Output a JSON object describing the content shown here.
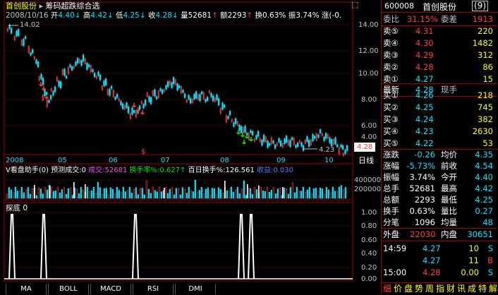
{
  "chart_header": {
    "stock_name": "首创股份",
    "indicator": "筹码超跌综合选",
    "date": "2008/10/16",
    "open_label": "开",
    "open": "4.40",
    "high_label": "高",
    "high": "4.42",
    "low_label": "低",
    "low": "4.25",
    "close_label": "收",
    "close": "4.28",
    "volume_label": "量",
    "volume": "52681",
    "amount_label": "额",
    "amount": "2293",
    "turnover_label": "换",
    "turnover": "0.63%",
    "amplitude_label": "振",
    "amplitude": "3.74%",
    "change_label": "涨",
    "change": "(-0.",
    "high_mark": "14.02",
    "low_mark": "4.23",
    "current_price_tag": "4.28"
  },
  "price_axis": [
    "14.00",
    "12.00",
    "10.00",
    "8.00",
    "6.00",
    "4.00"
  ],
  "date_axis": [
    "2008",
    "05",
    "06",
    "07",
    "08",
    "09",
    "10"
  ],
  "date_axis_right": "日线",
  "volume_header": {
    "title": "V看盘助手",
    "param": "(0)",
    "forecast_label": "预测成交:0",
    "deal_label": "成交:",
    "deal_value": "52681",
    "turnover_rate_label": "换手率%:",
    "turnover_rate_value": "0.627",
    "hundred_day_label": "百日换手%:",
    "hundred_day_value": "126.561",
    "income_label": "收益:",
    "income_value": "0.030"
  },
  "volume_axis": [
    "400000",
    "200000"
  ],
  "indicator_panel": {
    "title": "探底",
    "value": "0",
    "axis": [
      "1.00",
      "0.80",
      "0.60",
      "0.40",
      "0.20",
      "0.00"
    ]
  },
  "bottom_tabs": [
    "MA",
    "BOLL",
    "MACD",
    "RSI",
    "DMI"
  ],
  "quote_panel": {
    "code": "600008",
    "name": "首创股份",
    "badge": "(9)",
    "ratio_label": "委比",
    "ratio_value": "31.15%",
    "diff_label": "委差",
    "diff_value": "1913",
    "asks": [
      {
        "label": "卖⑤",
        "price": "4.31",
        "vol": "220"
      },
      {
        "label": "卖④",
        "price": "4.30",
        "vol": "1482"
      },
      {
        "label": "卖③",
        "price": "4.29",
        "vol": "312"
      },
      {
        "label": "卖②",
        "price": "4.28",
        "vol": "86"
      },
      {
        "label": "卖①",
        "price": "4.27",
        "vol": "15"
      }
    ],
    "last_label": "最新",
    "last_value": "4.28",
    "hand_label": "现手",
    "bids": [
      {
        "label": "买①",
        "price": "4.26",
        "vol": "218"
      },
      {
        "label": "买②",
        "price": "4.25",
        "vol": "745"
      },
      {
        "label": "买③",
        "price": "4.24",
        "vol": "382"
      },
      {
        "label": "买④",
        "price": "4.23",
        "vol": "2630"
      },
      {
        "label": "买⑤",
        "price": "4.22",
        "vol": "53"
      }
    ],
    "stats": [
      {
        "l1": "涨跌",
        "v1": "-0.26",
        "l2": "均价",
        "v2": "4.35"
      },
      {
        "l1": "涨幅",
        "v1": "-5.73%",
        "l2": "前收",
        "v2": "4.54"
      },
      {
        "l1": "振幅",
        "v1": "3.74%",
        "l2": "今开",
        "v2": "4.40"
      },
      {
        "l1": "总手",
        "v1": "52681",
        "l2": "最高",
        "v2": "4.42"
      },
      {
        "l1": "总额",
        "v1": "2293",
        "l2": "最低",
        "v2": "4.25"
      },
      {
        "l1": "换手",
        "v1": "0.63%",
        "l2": "量比",
        "v2": "0.27"
      },
      {
        "l1": "分笔",
        "v1": "1096",
        "l2": "均量",
        "v2": "48"
      }
    ],
    "outer_label": "外盘",
    "outer_value": "22030",
    "inner_label": "内盘",
    "inner_value": "30651",
    "ticks": [
      {
        "time": "14:59",
        "price": "4.27",
        "vol": "10",
        "side": "S"
      },
      {
        "time": "",
        "price": "4.27",
        "vol": "11",
        "side": "B"
      },
      {
        "time": "15:00",
        "price": "4.28",
        "vol": "0.00",
        "side": "S"
      }
    ],
    "bottom_tabs": [
      "细",
      "价",
      "盘",
      "势",
      "周",
      "指",
      "财",
      "讯",
      "成",
      "特",
      "解"
    ]
  },
  "colors": {
    "up": "#ff3c3c",
    "down": "#00e5ff",
    "grid": "#a00000",
    "bg": "#000000"
  }
}
